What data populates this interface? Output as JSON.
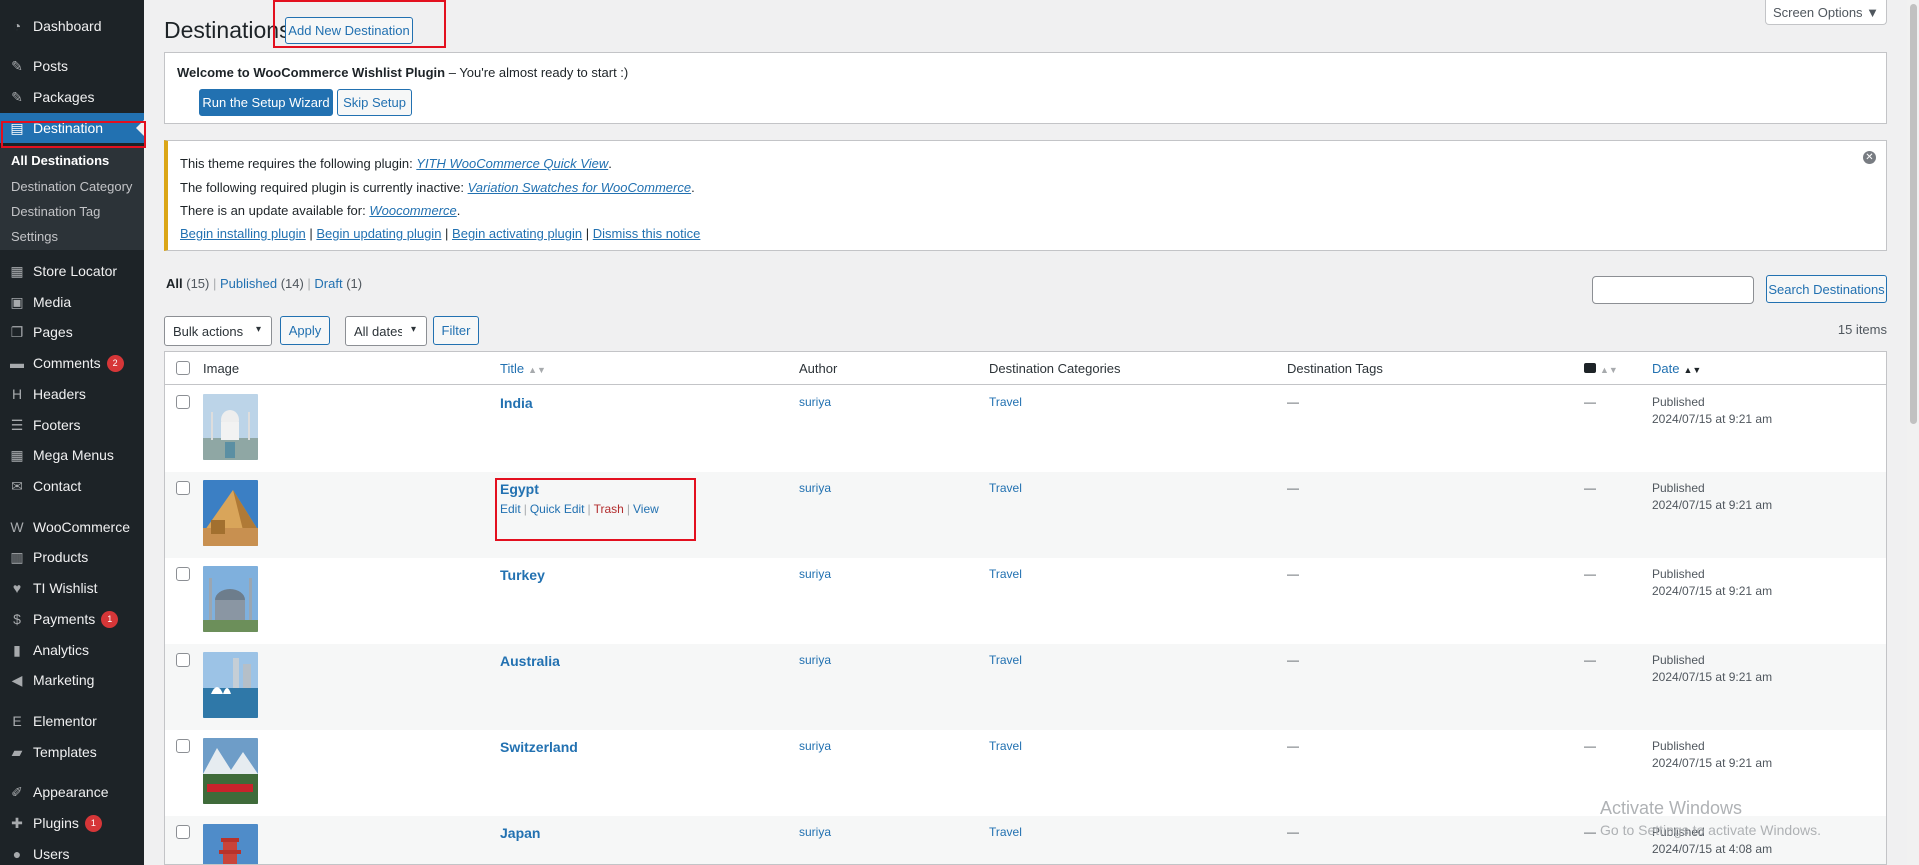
{
  "sidebar": {
    "items": [
      {
        "label": "Dashboard",
        "icon": "dashboard-icon",
        "glyph": "◔"
      },
      {
        "label": "Posts",
        "icon": "pin-icon",
        "glyph": "✎"
      },
      {
        "label": "Packages",
        "icon": "pin-icon",
        "glyph": "✎"
      },
      {
        "label": "Destination",
        "icon": "layout-icon",
        "glyph": "▤"
      },
      {
        "label": "Store Locator",
        "icon": "grid-icon",
        "glyph": "▦"
      },
      {
        "label": "Media",
        "icon": "media-icon",
        "glyph": "▣"
      },
      {
        "label": "Pages",
        "icon": "pages-icon",
        "glyph": "❐"
      },
      {
        "label": "Comments",
        "icon": "comment-icon",
        "glyph": "▬",
        "badge": "2"
      },
      {
        "label": "Headers",
        "icon": "heading-icon",
        "glyph": "H"
      },
      {
        "label": "Footers",
        "icon": "footer-icon",
        "glyph": "☰"
      },
      {
        "label": "Mega Menus",
        "icon": "table-icon",
        "glyph": "▦"
      },
      {
        "label": "Contact",
        "icon": "mail-icon",
        "glyph": "✉"
      },
      {
        "label": "WooCommerce",
        "icon": "woo-icon",
        "glyph": "W"
      },
      {
        "label": "Products",
        "icon": "archive-icon",
        "glyph": "▥"
      },
      {
        "label": "TI Wishlist",
        "icon": "heart-icon",
        "glyph": "♥"
      },
      {
        "label": "Payments",
        "icon": "money-icon",
        "glyph": "$",
        "badge": "1"
      },
      {
        "label": "Analytics",
        "icon": "chart-bar-icon",
        "glyph": "▮"
      },
      {
        "label": "Marketing",
        "icon": "megaphone-icon",
        "glyph": "◀"
      },
      {
        "label": "Elementor",
        "icon": "elementor-icon",
        "glyph": "E"
      },
      {
        "label": "Templates",
        "icon": "folder-icon",
        "glyph": "▰"
      },
      {
        "label": "Appearance",
        "icon": "brush-icon",
        "glyph": "✐"
      },
      {
        "label": "Plugins",
        "icon": "plugin-icon",
        "glyph": "✚",
        "badge": "1"
      },
      {
        "label": "Users",
        "icon": "user-icon",
        "glyph": "●"
      }
    ],
    "submenu": [
      "All Destinations",
      "Destination Category",
      "Destination Tag",
      "Settings"
    ]
  },
  "header": {
    "title": "Destinations",
    "add_new": "Add New Destination",
    "screen_options": "Screen Options ▼"
  },
  "notice_wishlist": {
    "text_bold": "Welcome to WooCommerce Wishlist Plugin",
    "text_rest": " – You're almost ready to start :)",
    "setup_button": "Run the Setup Wizard",
    "skip_button": "Skip Setup"
  },
  "notice_plugins": {
    "line1_prefix": "This theme requires the following plugin: ",
    "line1_link": "YITH WooCommerce Quick View",
    "line2_prefix": "The following required plugin is currently inactive: ",
    "line2_link": "Variation Swatches for WooCommerce",
    "line3_prefix": "There is an update available for: ",
    "line3_link": "Woocommerce",
    "dot": ".",
    "sep": " | ",
    "actions": [
      "Begin installing plugin",
      "Begin updating plugin",
      "Begin activating plugin",
      "Dismiss this notice"
    ]
  },
  "views": {
    "all_label": "All",
    "all_count": " (15)",
    "published_label": "Published",
    "published_count": " (14)",
    "draft_label": "Draft",
    "draft_count": " (1)",
    "sep": " | "
  },
  "search": {
    "placeholder": "",
    "button": "Search Destinations"
  },
  "filters": {
    "bulk_actions": "Bulk actions",
    "apply": "Apply",
    "dates": "All dates",
    "filter": "Filter",
    "items_count": "15 items"
  },
  "table": {
    "columns": {
      "image": "Image",
      "title": "Title",
      "author": "Author",
      "categories": "Destination Categories",
      "tags": "Destination Tags",
      "date": "Date"
    },
    "row_actions": {
      "edit": "Edit",
      "quick_edit": "Quick Edit",
      "trash": "Trash",
      "view": "View",
      "sep": "|"
    },
    "rows": [
      {
        "title": "India",
        "author": "suriya",
        "category": "Travel",
        "tags": "—",
        "comments": "—",
        "status": "Published",
        "date": "2024/07/15 at 9:21 am"
      },
      {
        "title": "Egypt",
        "author": "suriya",
        "category": "Travel",
        "tags": "—",
        "comments": "—",
        "status": "Published",
        "date": "2024/07/15 at 9:21 am"
      },
      {
        "title": "Turkey",
        "author": "suriya",
        "category": "Travel",
        "tags": "—",
        "comments": "—",
        "status": "Published",
        "date": "2024/07/15 at 9:21 am"
      },
      {
        "title": "Australia",
        "author": "suriya",
        "category": "Travel",
        "tags": "—",
        "comments": "—",
        "status": "Published",
        "date": "2024/07/15 at 9:21 am"
      },
      {
        "title": "Switzerland",
        "author": "suriya",
        "category": "Travel",
        "tags": "—",
        "comments": "—",
        "status": "Published",
        "date": "2024/07/15 at 9:21 am"
      },
      {
        "title": "Japan",
        "author": "suriya",
        "category": "Travel",
        "tags": "—",
        "comments": "—",
        "status": "Published",
        "date": "2024/07/15 at 4:08 am"
      }
    ]
  },
  "watermark": {
    "line1": "Activate Windows",
    "line2": "Go to Settings to activate Windows."
  },
  "colors": {
    "accent": "#2271b1",
    "sidebar": "#1d2327",
    "highlight": "#e3101f",
    "trash": "#b32d2e"
  }
}
